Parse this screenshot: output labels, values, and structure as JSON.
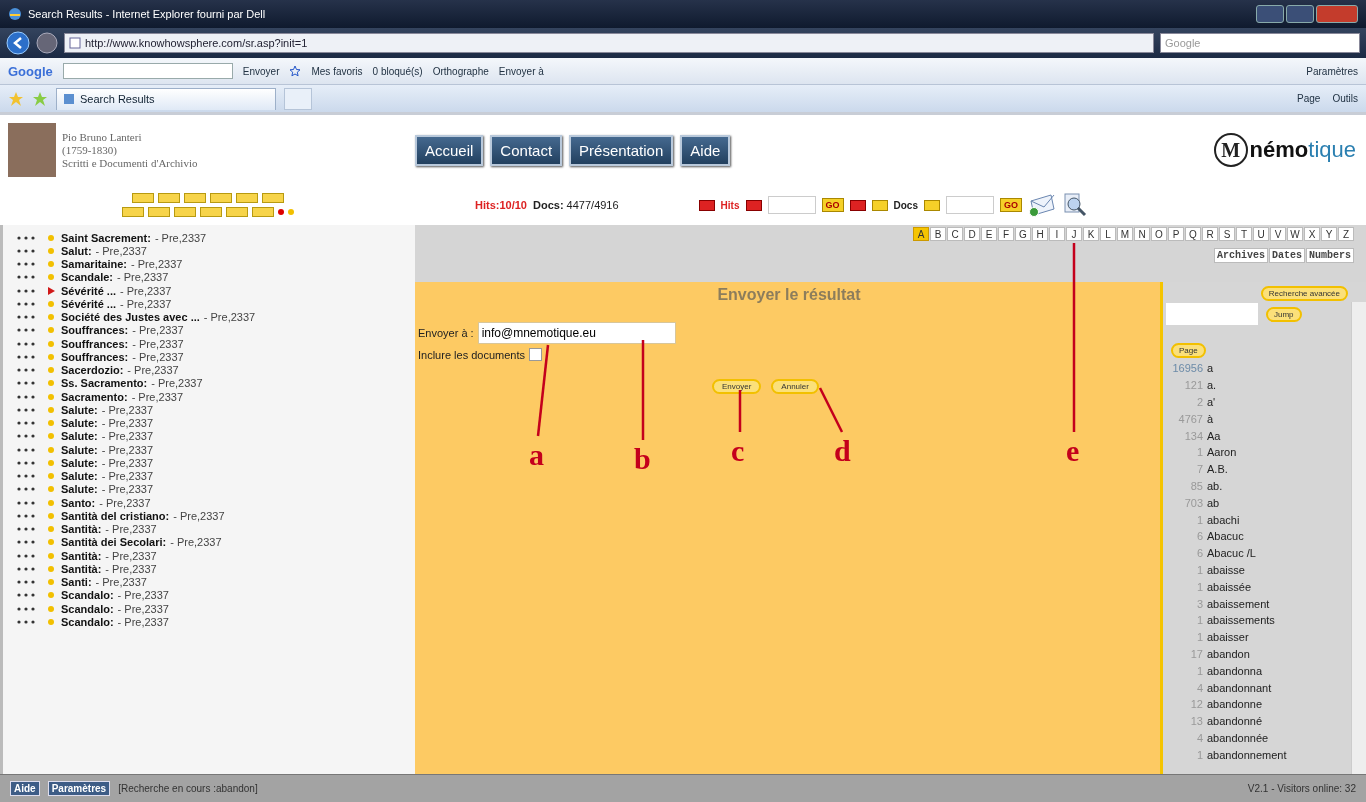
{
  "browser": {
    "title": "Search Results - Internet Explorer fourni par Dell",
    "url": "http://www.knowhowsphere.com/sr.asp?init=1",
    "search_placeholder": "Google",
    "toolbar": {
      "brand": "Google",
      "send": "Envoyer",
      "favorites": "Mes favoris",
      "blocked": "0 bloqué(s)",
      "spelling": "Orthographe",
      "send_to": "Envoyer à",
      "settings": "Paramètres"
    },
    "tab": "Search Results",
    "commands": [
      "Page",
      "Outils"
    ]
  },
  "site": {
    "person": [
      "Pio Bruno Lanteri",
      "(1759-1830)",
      "Scritti e Documenti d'Archivio"
    ],
    "nav": [
      {
        "label": "Accueil"
      },
      {
        "label": "Contact"
      },
      {
        "label": "Présentation"
      },
      {
        "label": "Aide"
      }
    ],
    "logo": {
      "initial": "M",
      "name": "**némo**tique"
    }
  },
  "stats": {
    "hits_label": "Hits:",
    "hits_value": "10/10",
    "docs_label": "Docs:",
    "docs_value": "4477/4916"
  },
  "pager": {
    "hits": "Hits",
    "go": "GO",
    "docs": "Docs",
    "go_docs": "GO"
  },
  "results": [
    {
      "kind": "dot",
      "term": "Saint Sacrement:",
      "ref": "- Pre,2337"
    },
    {
      "kind": "dot",
      "term": "Salut:",
      "ref": "- Pre,2337"
    },
    {
      "kind": "dot",
      "term": "Samaritaine:",
      "ref": "- Pre,2337"
    },
    {
      "kind": "dot",
      "term": "Scandale:",
      "ref": "- Pre,2337"
    },
    {
      "kind": "arrow",
      "term": "Sévérité ...",
      "ref": "- Pre,2337"
    },
    {
      "kind": "dot",
      "term": "Sévérité ...",
      "ref": "- Pre,2337"
    },
    {
      "kind": "dot",
      "term": "Société des Justes avec ...",
      "ref": "- Pre,2337"
    },
    {
      "kind": "dot",
      "term": "Souffrances:",
      "ref": "- Pre,2337"
    },
    {
      "kind": "dot",
      "term": "Souffrances:",
      "ref": "- Pre,2337"
    },
    {
      "kind": "dot",
      "term": "Souffrances:",
      "ref": "- Pre,2337"
    },
    {
      "kind": "dot",
      "term": "Sacerdozio:",
      "ref": "- Pre,2337"
    },
    {
      "kind": "dot",
      "term": "Ss. Sacramento:",
      "ref": "- Pre,2337"
    },
    {
      "kind": "dot",
      "term": "Sacramento:",
      "ref": "- Pre,2337"
    },
    {
      "kind": "dot",
      "term": "Salute:",
      "ref": "- Pre,2337"
    },
    {
      "kind": "dot",
      "term": "Salute:",
      "ref": "- Pre,2337"
    },
    {
      "kind": "dot",
      "term": "Salute:",
      "ref": "- Pre,2337"
    },
    {
      "kind": "dot",
      "term": "Salute:",
      "ref": "- Pre,2337"
    },
    {
      "kind": "dot",
      "term": "Salute:",
      "ref": "- Pre,2337"
    },
    {
      "kind": "dot",
      "term": "Salute:",
      "ref": "- Pre,2337"
    },
    {
      "kind": "dot",
      "term": "Salute:",
      "ref": "- Pre,2337"
    },
    {
      "kind": "dot",
      "term": "Santo:",
      "ref": "- Pre,2337"
    },
    {
      "kind": "dot",
      "term": "Santità del cristiano:",
      "ref": "- Pre,2337"
    },
    {
      "kind": "dot",
      "term": "Santità:",
      "ref": "- Pre,2337"
    },
    {
      "kind": "dot",
      "term": "Santità dei Secolari:",
      "ref": "- Pre,2337"
    },
    {
      "kind": "dot",
      "term": "Santità:",
      "ref": "- Pre,2337"
    },
    {
      "kind": "dot",
      "term": "Santità:",
      "ref": "- Pre,2337"
    },
    {
      "kind": "dot",
      "term": "Santi:",
      "ref": "- Pre,2337"
    },
    {
      "kind": "dot",
      "term": "Scandalo:",
      "ref": "- Pre,2337"
    },
    {
      "kind": "dot",
      "term": "Scandalo:",
      "ref": "- Pre,2337"
    },
    {
      "kind": "dot",
      "term": "Scandalo:",
      "ref": "- Pre,2337"
    }
  ],
  "alphabet": [
    {
      "letter": "A",
      "selected": true
    },
    {
      "letter": "B",
      "selected": false
    },
    {
      "letter": "C",
      "selected": false
    },
    {
      "letter": "D",
      "selected": false
    },
    {
      "letter": "E",
      "selected": false
    },
    {
      "letter": "F",
      "selected": false
    },
    {
      "letter": "G",
      "selected": false
    },
    {
      "letter": "H",
      "selected": false
    },
    {
      "letter": "I",
      "selected": false
    },
    {
      "letter": "J",
      "selected": false
    },
    {
      "letter": "K",
      "selected": false
    },
    {
      "letter": "L",
      "selected": false
    },
    {
      "letter": "M",
      "selected": false
    },
    {
      "letter": "N",
      "selected": false
    },
    {
      "letter": "O",
      "selected": false
    },
    {
      "letter": "P",
      "selected": false
    },
    {
      "letter": "Q",
      "selected": false
    },
    {
      "letter": "R",
      "selected": false
    },
    {
      "letter": "S",
      "selected": false
    },
    {
      "letter": "T",
      "selected": false
    },
    {
      "letter": "U",
      "selected": false
    },
    {
      "letter": "V",
      "selected": false
    },
    {
      "letter": "W",
      "selected": false
    },
    {
      "letter": "X",
      "selected": false
    },
    {
      "letter": "Y",
      "selected": false
    },
    {
      "letter": "Z",
      "selected": false
    }
  ],
  "views": [
    "Archives",
    "Dates",
    "Numbers"
  ],
  "form": {
    "title": "Envoyer le résultat",
    "to_label": "Envoyer à :",
    "to_value": "info@mnemotique.eu",
    "include_label": "Inclure les documents",
    "include_checked": false,
    "buttons": [
      "Envoyer",
      "Annuler"
    ]
  },
  "index": {
    "advanced": "Recherche avancée",
    "jump": "Jump",
    "page": "Page",
    "entries": [
      {
        "count": "16956",
        "word": "a"
      },
      {
        "count": "121",
        "word": "a."
      },
      {
        "count": "2",
        "word": "a'"
      },
      {
        "count": "4767",
        "word": "à"
      },
      {
        "count": "134",
        "word": "Aa"
      },
      {
        "count": "1",
        "word": "Aaron"
      },
      {
        "count": "7",
        "word": "A.B."
      },
      {
        "count": "85",
        "word": "ab."
      },
      {
        "count": "703",
        "word": "ab"
      },
      {
        "count": "1",
        "word": "abachi"
      },
      {
        "count": "6",
        "word": "Abacuc"
      },
      {
        "count": "6",
        "word": "Abacuc /L"
      },
      {
        "count": "1",
        "word": "abaisse"
      },
      {
        "count": "1",
        "word": "abaissée"
      },
      {
        "count": "3",
        "word": "abaissement"
      },
      {
        "count": "1",
        "word": "abaissements"
      },
      {
        "count": "1",
        "word": "abaisser"
      },
      {
        "count": "17",
        "word": "abandon"
      },
      {
        "count": "1",
        "word": "abandonna"
      },
      {
        "count": "4",
        "word": "abandonnant"
      },
      {
        "count": "12",
        "word": "abandonne"
      },
      {
        "count": "13",
        "word": "abandonné"
      },
      {
        "count": "4",
        "word": "abandonnée"
      },
      {
        "count": "1",
        "word": "abandonnement"
      }
    ]
  },
  "status": {
    "buttons": [
      "Aide",
      "Paramètres"
    ],
    "message": "[Recherche en cours :abandon]",
    "version": "V2.1 - Visitors online: 32"
  },
  "callouts": [
    {
      "label": "a"
    },
    {
      "label": "b"
    },
    {
      "label": "c"
    },
    {
      "label": "d"
    },
    {
      "label": "e"
    }
  ]
}
